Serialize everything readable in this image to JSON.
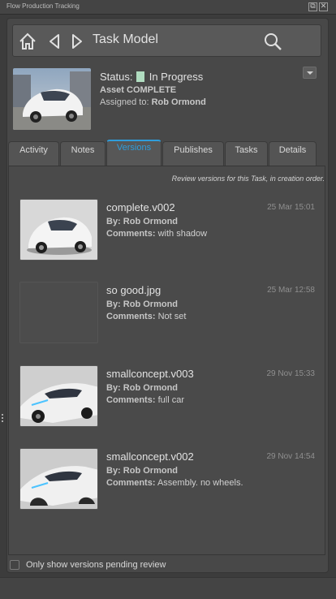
{
  "window": {
    "title": "Flow Production Tracking"
  },
  "nav": {
    "title": "Task Model"
  },
  "task": {
    "status_label": "Status:",
    "status_value": "In Progress",
    "status_color": "#b0dcc0",
    "asset_line": "Asset COMPLETE",
    "assigned_label": "Assigned to:",
    "assigned_name": "Rob Ormond"
  },
  "tabs": [
    {
      "label": "Activity"
    },
    {
      "label": "Notes"
    },
    {
      "label": "Versions",
      "active": true
    },
    {
      "label": "Publishes"
    },
    {
      "label": "Tasks"
    },
    {
      "label": "Details"
    }
  ],
  "accent_color": "#2f9ddb",
  "versions_caption": "Review versions for this Task, in creation order.",
  "versions": [
    {
      "name": "complete.v002",
      "date": "25 Mar 15:01",
      "by_label": "By:",
      "by": "Rob Ormond",
      "comments_label": "Comments:",
      "comments": "with shadow"
    },
    {
      "name": "so good.jpg",
      "date": "25 Mar 12:58",
      "by_label": "By:",
      "by": "Rob Ormond",
      "comments_label": "Comments:",
      "comments": "Not set"
    },
    {
      "name": "smallconcept.v003",
      "date": "29 Nov 15:33",
      "by_label": "By:",
      "by": "Rob Ormond",
      "comments_label": "Comments:",
      "comments": "full car"
    },
    {
      "name": "smallconcept.v002",
      "date": "29 Nov 14:54",
      "by_label": "By:",
      "by": "Rob Ormond",
      "comments_label": "Comments:",
      "comments": "Assembly. no wheels."
    }
  ],
  "footer": {
    "pending_label": "Only show versions pending review",
    "pending_checked": false
  }
}
